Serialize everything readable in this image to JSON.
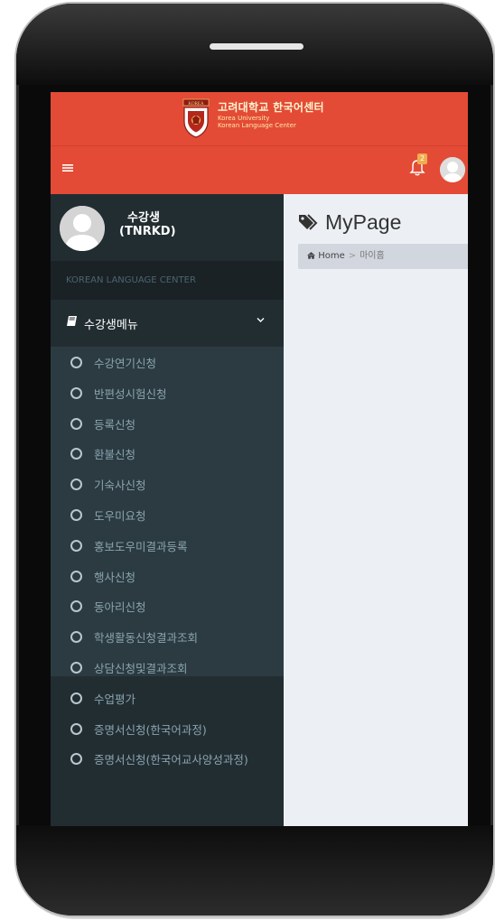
{
  "brand": {
    "title_ko": "고려대학교 한국어센터",
    "line1": "Korea University",
    "line2": "Korean Language Center",
    "shield_text": "KOREA"
  },
  "navbar": {
    "menu_icon": "hamburger-icon",
    "notification_count": "2"
  },
  "user": {
    "name": "수강생",
    "id": "(TNRKD)"
  },
  "sidebar": {
    "header": "KOREAN LANGUAGE CENTER",
    "menu_title": "수강생메뉴",
    "items": [
      {
        "label": "수강연기신청"
      },
      {
        "label": "반편성시험신청"
      },
      {
        "label": "등록신청"
      },
      {
        "label": "환불신청"
      },
      {
        "label": "기숙사신청"
      },
      {
        "label": "도우미요청"
      },
      {
        "label": "홍보도우미결과등록"
      },
      {
        "label": "행사신청"
      },
      {
        "label": "동아리신청"
      },
      {
        "label": "학생활동신청결과조회"
      },
      {
        "label": "상담신청및결과조회"
      },
      {
        "label": "수업평가"
      },
      {
        "label": "증명서신청(한국어과정)"
      },
      {
        "label": "증명서신청(한국어교사양성과정)"
      }
    ]
  },
  "content": {
    "title": "MyPage",
    "breadcrumb_home": "Home",
    "breadcrumb_sep": ">",
    "breadcrumb_current": "마이홈"
  },
  "colors": {
    "header_red": "#e34b36",
    "sidebar_dark": "#222d32",
    "submenu_bg": "#2c3b41",
    "badge": "#f0ad4e",
    "content_bg": "#ecf0f5"
  }
}
